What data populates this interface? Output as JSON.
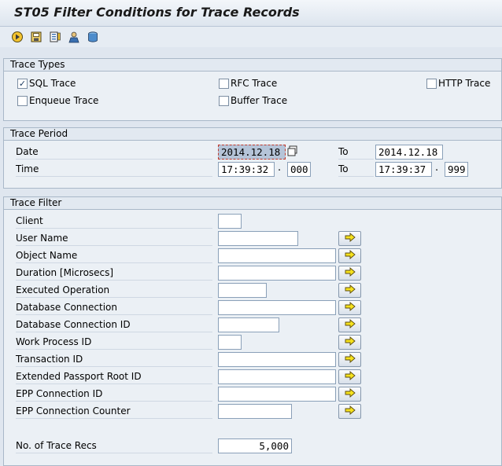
{
  "title": "ST05 Filter Conditions for Trace Records",
  "toolbar": {
    "icons": [
      "execute-icon",
      "save-icon",
      "variant-icon",
      "user-icon",
      "database-icon"
    ]
  },
  "trace_types": {
    "header": "Trace Types",
    "sql": {
      "label": "SQL Trace",
      "checked": true
    },
    "rfc": {
      "label": "RFC Trace",
      "checked": false
    },
    "http": {
      "label": "HTTP Trace",
      "checked": false
    },
    "enqueue": {
      "label": "Enqueue Trace",
      "checked": false
    },
    "buffer": {
      "label": "Buffer Trace",
      "checked": false
    }
  },
  "trace_period": {
    "header": "Trace Period",
    "date_label": "Date",
    "time_label": "Time",
    "to_label": "To",
    "date_from": "2014.12.18",
    "date_to": "2014.12.18",
    "time_from": "17:39:32",
    "time_from_ms": "000",
    "time_to": "17:39:37",
    "time_to_ms": "999",
    "dot": "."
  },
  "trace_filter": {
    "header": "Trace Filter",
    "client": {
      "label": "Client",
      "value": ""
    },
    "user_name": {
      "label": "User Name",
      "value": ""
    },
    "object_name": {
      "label": "Object Name",
      "value": ""
    },
    "duration": {
      "label": "Duration [Microsecs]",
      "value": ""
    },
    "executed_operation": {
      "label": "Executed Operation",
      "value": ""
    },
    "db_connection": {
      "label": "Database Connection",
      "value": ""
    },
    "db_connection_id": {
      "label": "Database Connection ID",
      "value": ""
    },
    "work_process_id": {
      "label": "Work Process ID",
      "value": ""
    },
    "transaction_id": {
      "label": "Transaction ID",
      "value": ""
    },
    "passport_root_id": {
      "label": "Extended Passport Root ID",
      "value": ""
    },
    "epp_connection_id": {
      "label": "EPP Connection ID",
      "value": ""
    },
    "epp_connection_counter": {
      "label": "EPP Connection Counter",
      "value": ""
    },
    "num_trace_recs": {
      "label": "No. of Trace Recs",
      "value": "5,000"
    }
  }
}
